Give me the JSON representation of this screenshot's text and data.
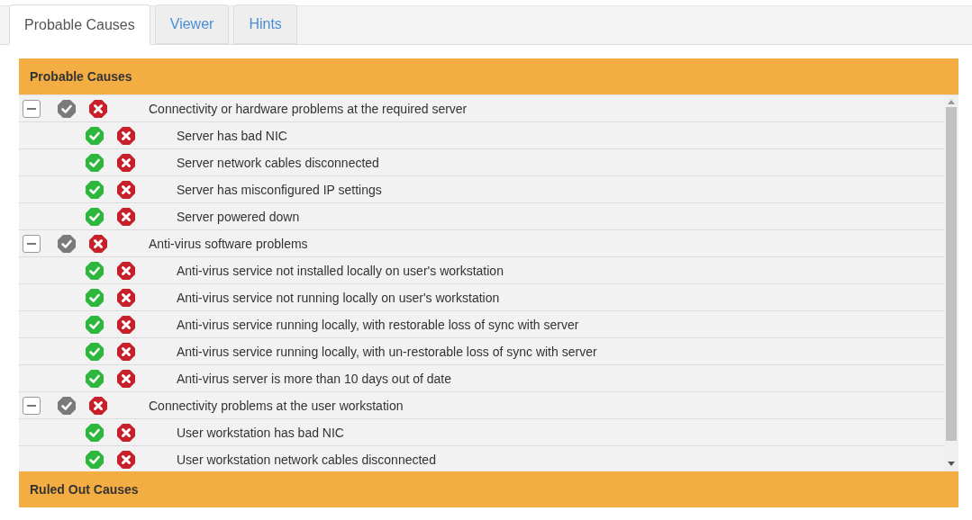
{
  "tabs": [
    {
      "label": "Probable Causes",
      "selected": true
    },
    {
      "label": "Viewer",
      "selected": false
    },
    {
      "label": "Hints",
      "selected": false
    }
  ],
  "probable_causes": {
    "title": "Probable Causes",
    "groups": [
      {
        "label": "Connectivity or hardware problems at the required server",
        "expanded": true,
        "children": [
          {
            "label": "Server has bad NIC"
          },
          {
            "label": "Server network cables disconnected"
          },
          {
            "label": "Server has misconfigured IP settings"
          },
          {
            "label": "Server powered down"
          }
        ]
      },
      {
        "label": "Anti-virus software problems",
        "expanded": true,
        "children": [
          {
            "label": "Anti-virus service not installed locally on user's workstation"
          },
          {
            "label": "Anti-virus service not running locally on user's workstation"
          },
          {
            "label": "Anti-virus service running locally, with restorable loss of sync with server"
          },
          {
            "label": "Anti-virus service running locally, with un-restorable loss of sync with server"
          },
          {
            "label": "Anti-virus server is more than 10 days out of date"
          }
        ]
      },
      {
        "label": "Connectivity problems at the user workstation",
        "expanded": true,
        "children": [
          {
            "label": "User workstation has bad NIC"
          },
          {
            "label": "User workstation network cables disconnected"
          }
        ]
      }
    ]
  },
  "ruled_out_causes": {
    "title": "Ruled Out Causes"
  }
}
